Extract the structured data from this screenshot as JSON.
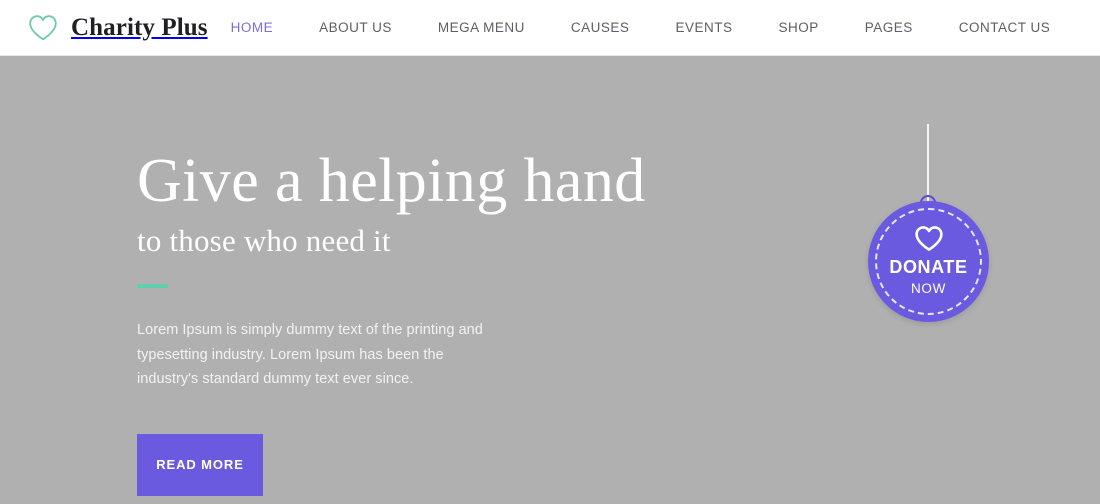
{
  "header": {
    "brand": {
      "icon": "heart-outline-icon",
      "name": "Charity Plus",
      "icon_color": "#6fc9a8"
    },
    "nav": [
      {
        "label": "HOME",
        "active": true
      },
      {
        "label": "ABOUT US",
        "active": false
      },
      {
        "label": "MEGA MENU",
        "active": false
      },
      {
        "label": "CAUSES",
        "active": false
      },
      {
        "label": "EVENTS",
        "active": false
      },
      {
        "label": "SHOP",
        "active": false
      },
      {
        "label": "PAGES",
        "active": false
      },
      {
        "label": "CONTACT US",
        "active": false
      }
    ]
  },
  "hero": {
    "background_color": "#b0b0b0",
    "title": "Give a helping hand",
    "subtitle": "to those who need it",
    "rule_color": "#5fd0ae",
    "paragraph": "Lorem Ipsum is simply dummy text of the printing and typesetting industry. Lorem Ipsum has been the industry's standard dummy text ever since.",
    "cta_label": "READ MORE",
    "cta_color": "#6a5ae0"
  },
  "donate": {
    "icon": "heart-outline-icon",
    "label": "DONATE",
    "sublabel": "NOW",
    "badge_color": "#6a5ae0",
    "string_color": "#f4f4f4"
  },
  "theme": {
    "accent_purple": "#6a5ae0",
    "accent_teal": "#5fd0ae",
    "nav_active": "#7a6fe0",
    "nav_idle": "#5e5e64"
  }
}
